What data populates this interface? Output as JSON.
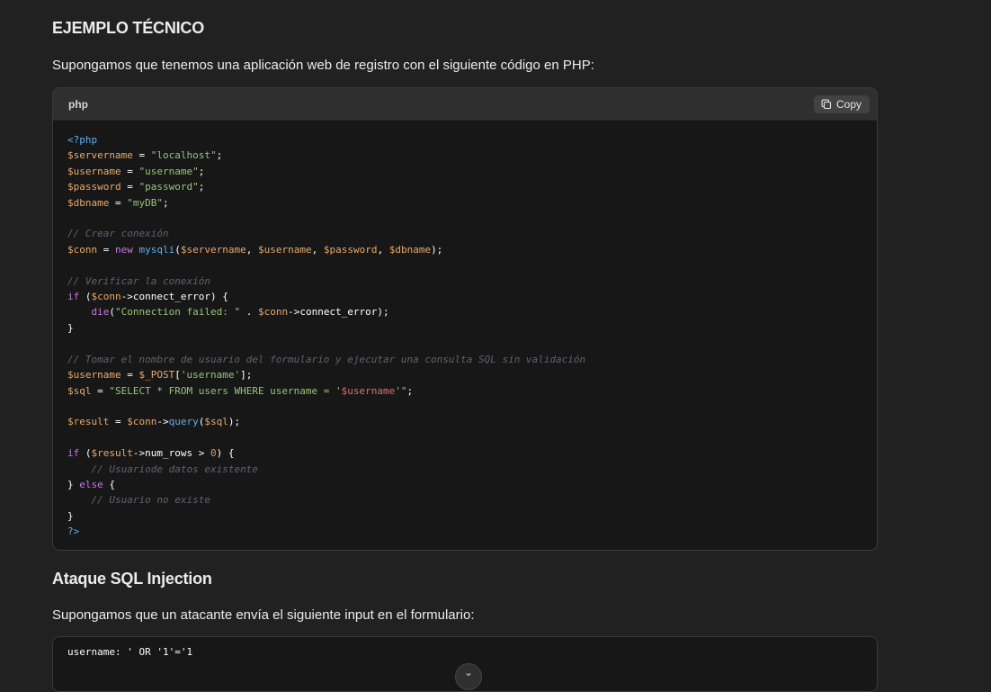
{
  "sections": {
    "example_title": "EJEMPLO TÉCNICO",
    "example_intro": "Supongamos que tenemos una aplicación web de registro con el siguiente código en PHP:",
    "attack_title": "Ataque SQL Injection",
    "attack_intro": "Supongamos que un atacante envía el siguiente input en el formulario:"
  },
  "code_block": {
    "language": "php",
    "copy_label": "Copy",
    "lines": [
      "<?php",
      "$servername = \"localhost\";",
      "$username = \"username\";",
      "$password = \"password\";",
      "$dbname = \"myDB\";",
      "",
      "// Crear conexión",
      "$conn = new mysqli($servername, $username, $password, $dbname);",
      "",
      "// Verificar la conexión",
      "if ($conn->connect_error) {",
      "    die(\"Connection failed: \" . $conn->connect_error);",
      "}",
      "",
      "// Tomar el nombre de usuario del formulario y ejecutar una consulta SQL sin validación",
      "$username = $_POST['username'];",
      "$sql = \"SELECT * FROM users WHERE username = '$username'\";",
      "",
      "$result = $conn->query($sql);",
      "",
      "if ($result->num_rows > 0) {",
      "    // Usuariode datos existente",
      "} else {",
      "    // Usuario no existe",
      "}",
      "?>"
    ]
  },
  "input_block": {
    "text": "username: ' OR '1'='1"
  },
  "icons": {
    "copy": "copy-icon",
    "scroll": "chevron-down-icon"
  },
  "colors": {
    "background": "#212121",
    "code_bg": "#171717",
    "header_bg": "#2f2f2f",
    "variable": "#e8a96a",
    "string": "#98c379",
    "keyword": "#c678dd",
    "function": "#61afef",
    "comment": "#5c6370"
  }
}
